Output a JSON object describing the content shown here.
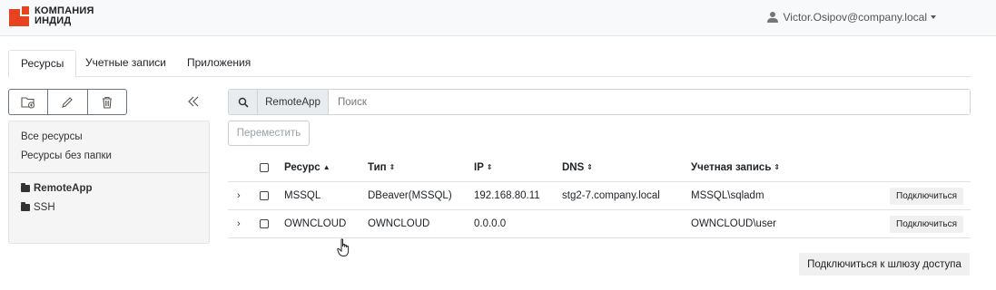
{
  "header": {
    "logo_line1": "КОМПАНИЯ",
    "logo_line2": "ИНДИД",
    "user": "Victor.Osipov@company.local",
    "brand_color": "#e8431f"
  },
  "tabs": [
    {
      "label": "Ресурсы",
      "active": true
    },
    {
      "label": "Учетные записи",
      "active": false
    },
    {
      "label": "Приложения",
      "active": false
    }
  ],
  "toolbar": {
    "icons": [
      "new-folder-icon",
      "pencil-icon",
      "trash-icon"
    ],
    "collapse_icon": "double-chevron-left-icon"
  },
  "sidebar": {
    "items": [
      {
        "label": "Все ресурсы"
      },
      {
        "label": "Ресурсы без папки"
      }
    ],
    "folders": [
      {
        "label": "RemoteApp",
        "selected": true
      },
      {
        "label": "SSH",
        "selected": false
      }
    ]
  },
  "search": {
    "tag": "RemoteApp",
    "placeholder": "Поиск",
    "value": ""
  },
  "move_button": "Переместить",
  "table": {
    "columns": [
      {
        "label": "Ресурс",
        "sort": "asc"
      },
      {
        "label": "Тип",
        "sort": "both"
      },
      {
        "label": "IP",
        "sort": "both"
      },
      {
        "label": "DNS",
        "sort": "both"
      },
      {
        "label": "Учетная запись",
        "sort": "both"
      }
    ],
    "rows": [
      {
        "resource": "MSSQL",
        "type": "DBeaver(MSSQL)",
        "ip": "192.168.80.11",
        "dns": "stg2-7.company.local",
        "account": "MSSQL\\sqladm",
        "action": "Подключиться"
      },
      {
        "resource": "OWNCLOUD",
        "type": "OWNCLOUD",
        "ip": "0.0.0.0",
        "dns": "",
        "account": "OWNCLOUD\\user",
        "action": "Подключиться"
      }
    ]
  },
  "gateway_button": "Подключиться к шлюзу доступа"
}
